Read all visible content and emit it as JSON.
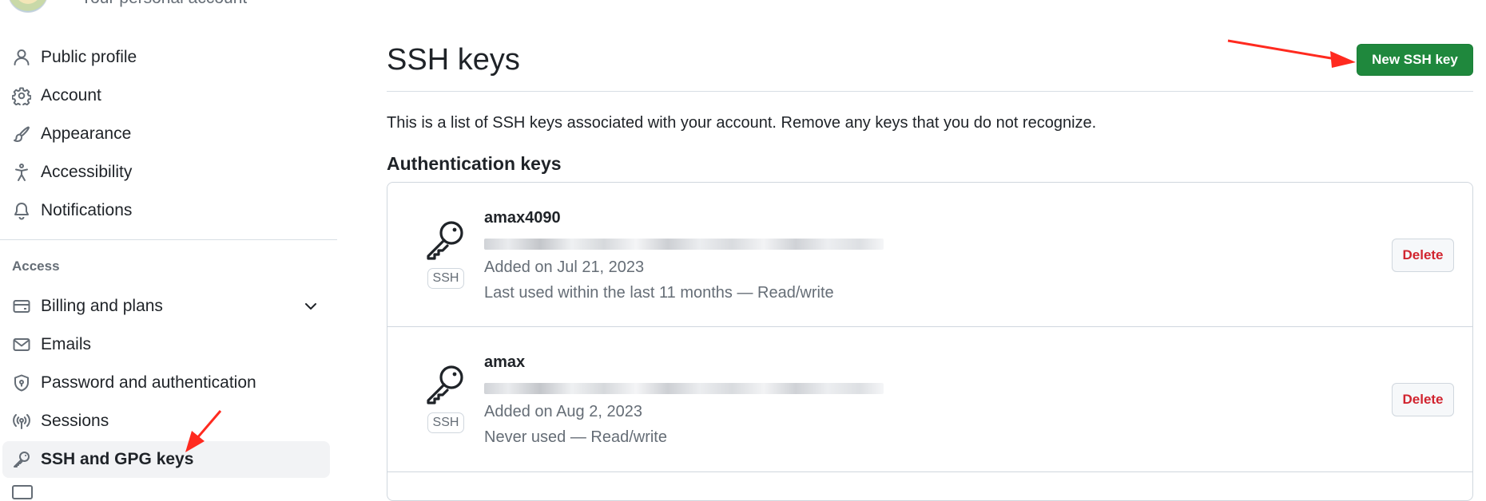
{
  "profile": {
    "subtitle": "Your personal account"
  },
  "sidebar": {
    "items": [
      {
        "label": "Public profile",
        "icon": "person-icon"
      },
      {
        "label": "Account",
        "icon": "gear-icon"
      },
      {
        "label": "Appearance",
        "icon": "paintbrush-icon"
      },
      {
        "label": "Accessibility",
        "icon": "accessibility-icon"
      },
      {
        "label": "Notifications",
        "icon": "bell-icon"
      }
    ],
    "access_heading": "Access",
    "access_items": [
      {
        "label": "Billing and plans",
        "icon": "credit-card-icon",
        "has_chevron": true
      },
      {
        "label": "Emails",
        "icon": "mail-icon"
      },
      {
        "label": "Password and authentication",
        "icon": "shield-lock-icon"
      },
      {
        "label": "Sessions",
        "icon": "broadcast-icon"
      },
      {
        "label": "SSH and GPG keys",
        "icon": "key-icon",
        "active": true
      }
    ]
  },
  "main": {
    "title": "SSH keys",
    "new_button": "New SSH key",
    "description": "This is a list of SSH keys associated with your account. Remove any keys that you do not recognize.",
    "section_heading": "Authentication keys",
    "keys": [
      {
        "name": "amax4090",
        "type_badge": "SSH",
        "added": "Added on Jul 21, 2023",
        "usage": "Last used within the last 11 months — Read/write",
        "delete_label": "Delete"
      },
      {
        "name": "amax",
        "type_badge": "SSH",
        "added": "Added on Aug 2, 2023",
        "usage": "Never used — Read/write",
        "delete_label": "Delete"
      }
    ]
  },
  "colors": {
    "primary_button": "#1f883d",
    "danger_text": "#d1242f",
    "annotation_arrow": "#ff2a1f",
    "active_nav_bg": "#f2f3f5"
  }
}
